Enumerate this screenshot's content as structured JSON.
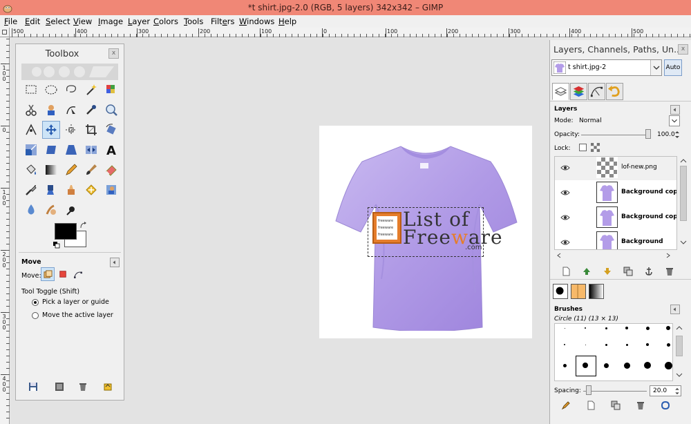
{
  "window": {
    "title": "*t shirt.jpg-2.0 (RGB, 5 layers) 342x342 – GIMP"
  },
  "menu": [
    {
      "pre": "",
      "u": "F",
      "post": "ile"
    },
    {
      "pre": "",
      "u": "E",
      "post": "dit"
    },
    {
      "pre": "",
      "u": "S",
      "post": "elect"
    },
    {
      "pre": "",
      "u": "V",
      "post": "iew"
    },
    {
      "pre": "",
      "u": "I",
      "post": "mage"
    },
    {
      "pre": "",
      "u": "L",
      "post": "ayer"
    },
    {
      "pre": "",
      "u": "C",
      "post": "olors"
    },
    {
      "pre": "",
      "u": "T",
      "post": "ools"
    },
    {
      "pre": "Filt",
      "u": "e",
      "post": "rs"
    },
    {
      "pre": "",
      "u": "W",
      "post": "indows"
    },
    {
      "pre": "",
      "u": "H",
      "post": "elp"
    }
  ],
  "hruler_labels": [
    "500",
    "400",
    "300",
    "200",
    "100",
    "0",
    "100",
    "200",
    "300",
    "400",
    "500"
  ],
  "vruler_labels": [
    "100",
    "0",
    "100",
    "200",
    "300",
    "400"
  ],
  "toolbox": {
    "title": "Toolbox",
    "close": "x",
    "options": {
      "title": "Move",
      "move_label": "Move:",
      "toggle_label": "Tool Toggle  (Shift)",
      "radio1": "Pick a layer or guide",
      "radio2": "Move the active layer"
    }
  },
  "dock": {
    "title": "Layers, Channels, Paths, Un...",
    "image_combo": "t shirt.jpg-2",
    "auto_label": "Auto",
    "layers": {
      "title": "Layers",
      "mode_label": "Mode:",
      "mode_value": "Normal",
      "opacity_label": "Opacity:",
      "opacity_value": "100.0",
      "lock_label": "Lock:",
      "rows": [
        {
          "name": "lof-new.png"
        },
        {
          "name": "Background cop"
        },
        {
          "name": "Background cop"
        },
        {
          "name": "Background"
        }
      ]
    },
    "brushes": {
      "title": "Brushes",
      "brush_name": "Circle (11) (13 × 13)",
      "spacing_label": "Spacing:",
      "spacing_value": "20.0"
    }
  },
  "canvas_image": {
    "logo_line1": "List of",
    "logo_line2_a": "Free",
    "logo_line2_b": "w",
    "logo_line2_c": "are",
    "logo_line3": ".com",
    "logo_badge": [
      "freeware",
      "freeware",
      "freeware"
    ]
  },
  "colors": {
    "titlebar": "#f08776",
    "shirt": "#b39ce8",
    "accent": "#e57d2b"
  }
}
